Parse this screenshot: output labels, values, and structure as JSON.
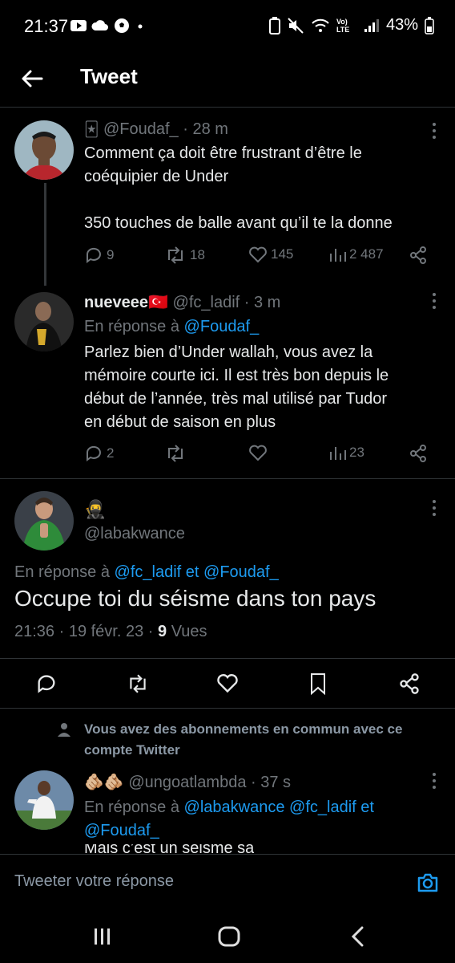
{
  "status": {
    "time": "21:37",
    "battery": "43%",
    "network": "Vo) LTE"
  },
  "header": {
    "title": "Tweet"
  },
  "tweet1": {
    "handle": "@Foudaf_",
    "time": "· 28 m",
    "text_line1": "Comment ça doit être frustrant d’être le",
    "text_line2": "coéquipier de Under",
    "text_line3": "350 touches de balle avant qu’il te la donne",
    "replies": "9",
    "retweets": "18",
    "likes": "145",
    "views": "2 487"
  },
  "tweet2": {
    "name": "nueveee",
    "flag": "🇹🇷",
    "handle": "@fc_ladif",
    "time": "· 3 m",
    "reply_prefix": "En réponse à",
    "reply_to": "@Foudaf_",
    "text_line1": "Parlez bien d’Under wallah, vous avez la",
    "text_line2": "mémoire courte ici. Il est très bon depuis le",
    "text_line3": "début de l’année, très mal utilisé par Tudor",
    "text_line4": "en début de saison en plus",
    "replies": "2",
    "views": "23"
  },
  "tweet3": {
    "name_emoji": "🥷",
    "handle": "@labakwance",
    "reply_prefix": "En réponse à",
    "reply_to_1": "@fc_ladif",
    "reply_and": "et",
    "reply_to_2": "@Foudaf_",
    "text": "Occupe toi du séisme  dans ton pays",
    "timestamp": "21:36 · 19 févr. 23 ·",
    "views_count": "9",
    "views_label": "Vues"
  },
  "common_follows": {
    "line1": "Vous avez des abonnements en commun avec ce",
    "line2": "compte Twitter"
  },
  "tweet4": {
    "name_emoji": "🫵🏼🫵🏼",
    "handle": "@ungoatlambda",
    "time": "· 37 s",
    "reply_prefix": "En réponse à",
    "reply_to_1": "@labakwance",
    "reply_to_2": "@fc_ladif",
    "reply_and": "et",
    "reply_to_3": "@Foudaf_",
    "partial_text": "Mais c’est un séisme sa"
  },
  "composer": {
    "placeholder": "Tweeter votre réponse"
  },
  "colors": {
    "accent": "#1d9bf0",
    "muted": "#71767b",
    "background": "#000000"
  }
}
